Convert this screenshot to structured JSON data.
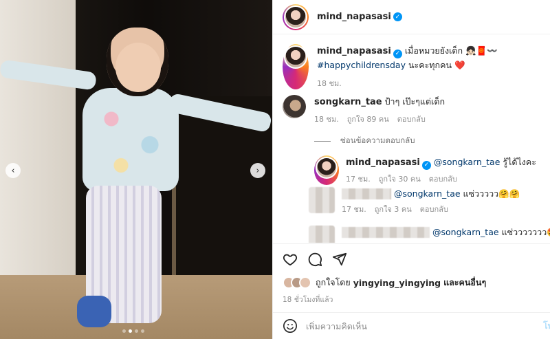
{
  "header": {
    "username": "mind_napasasi"
  },
  "caption": {
    "username": "mind_napasasi",
    "text": "เมื่อหมวยยังเด็ก 👧🏻🧧〰️",
    "hashtag": "#happychildrensday",
    "text2": "นะคะทุกคน",
    "heart": "❤️",
    "time": "18 ชม."
  },
  "comment1": {
    "username": "songkarn_tae",
    "text": "ป้าๆ เป๊ะๆแต่เด็ก",
    "time": "18 ชม.",
    "likes": "ถูกใจ 89 คน",
    "reply_label": "ตอบกลับ"
  },
  "replies_toggle": "ซ่อนข้อความตอบกลับ",
  "reply1": {
    "username": "mind_napasasi",
    "mention": "@songkarn_tae",
    "text": "รู้ได้ไงคะ",
    "time": "17 ชม.",
    "likes": "ถูกใจ 30 คน",
    "reply_label": "ตอบกลับ"
  },
  "reply2": {
    "mention": "@songkarn_tae",
    "text": "แซ่ววววว🤗🤗",
    "time": "17 ชม.",
    "likes": "ถูกใจ 3 คน",
    "reply_label": "ตอบกลับ"
  },
  "reply3": {
    "mention": "@songkarn_tae",
    "text": "แซ่ววววววว🤩"
  },
  "likes": {
    "prefix": "ถูกใจโดย",
    "user": "yingying_yingying",
    "suffix": "และคนอื่นๆ"
  },
  "time_ago": "18 ชั่วโมงที่แล้ว",
  "add_comment": {
    "placeholder": "เพิ่มความคิดเห็น",
    "post_label": "โพ"
  },
  "nav": {
    "prev": "‹",
    "next": "›"
  },
  "colors": {
    "link": "#00376b",
    "verified": "#0095f6",
    "meta": "#8e8e8e"
  },
  "icons": [
    "heart-icon",
    "comment-icon",
    "share-icon",
    "emoji-icon",
    "verified-icon"
  ]
}
